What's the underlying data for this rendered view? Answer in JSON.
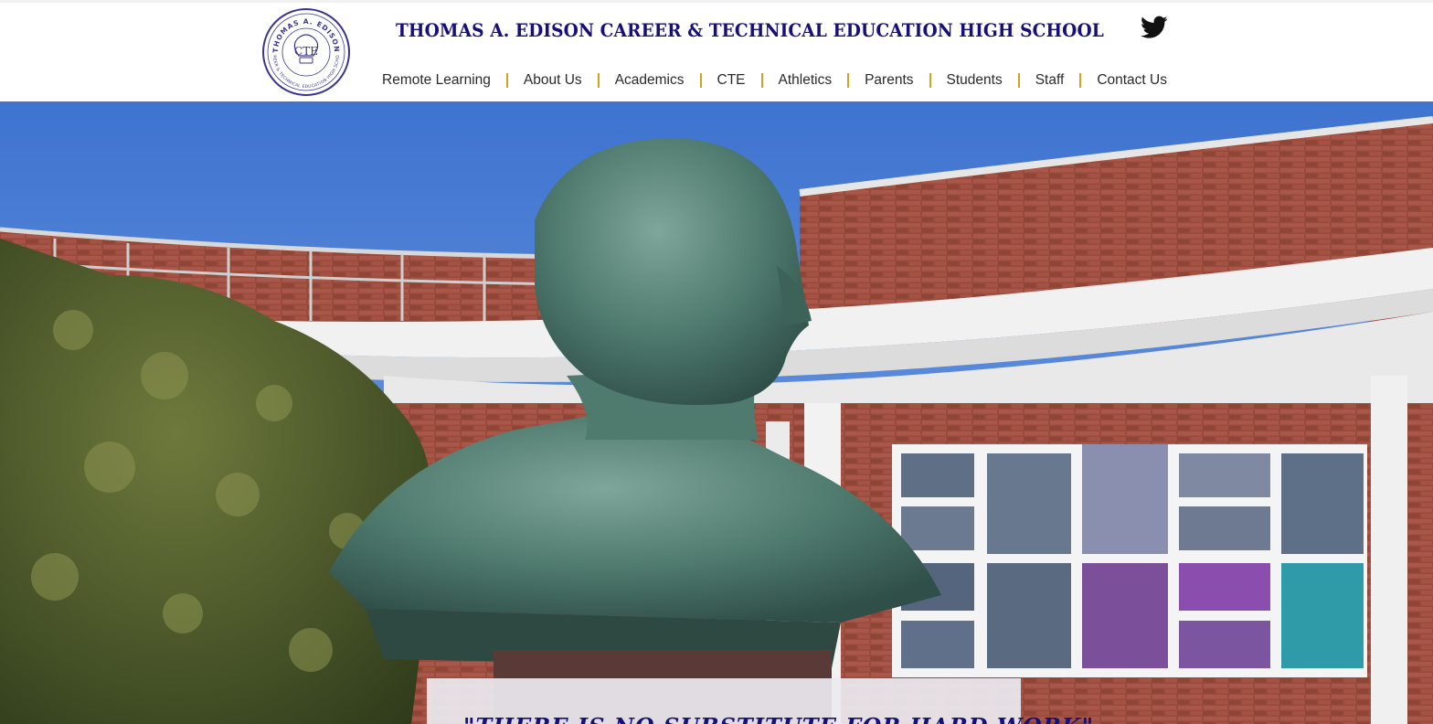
{
  "header": {
    "title": "THOMAS A. EDISON CAREER & TECHNICAL EDUCATION HIGH SCHOOL",
    "logo": {
      "initials": "CTE",
      "ring_top": "THOMAS A. EDISON",
      "ring_bottom": "CAREER & TECHNICAL EDUCATION HIGH SCHOOL"
    },
    "social_icon": "twitter-icon"
  },
  "nav": {
    "items": [
      {
        "label": "Remote Learning"
      },
      {
        "label": "About Us"
      },
      {
        "label": "Academics"
      },
      {
        "label": "CTE"
      },
      {
        "label": "Athletics"
      },
      {
        "label": "Parents"
      },
      {
        "label": "Students"
      },
      {
        "label": "Staff"
      },
      {
        "label": "Contact Us"
      }
    ]
  },
  "hero": {
    "quote": "\"THERE IS NO SUBSTITUTE FOR HARD WORK\""
  },
  "colors": {
    "brand_navy": "#16107a",
    "nav_separator": "#d9a21a",
    "nav_text": "#2a2a2a"
  }
}
